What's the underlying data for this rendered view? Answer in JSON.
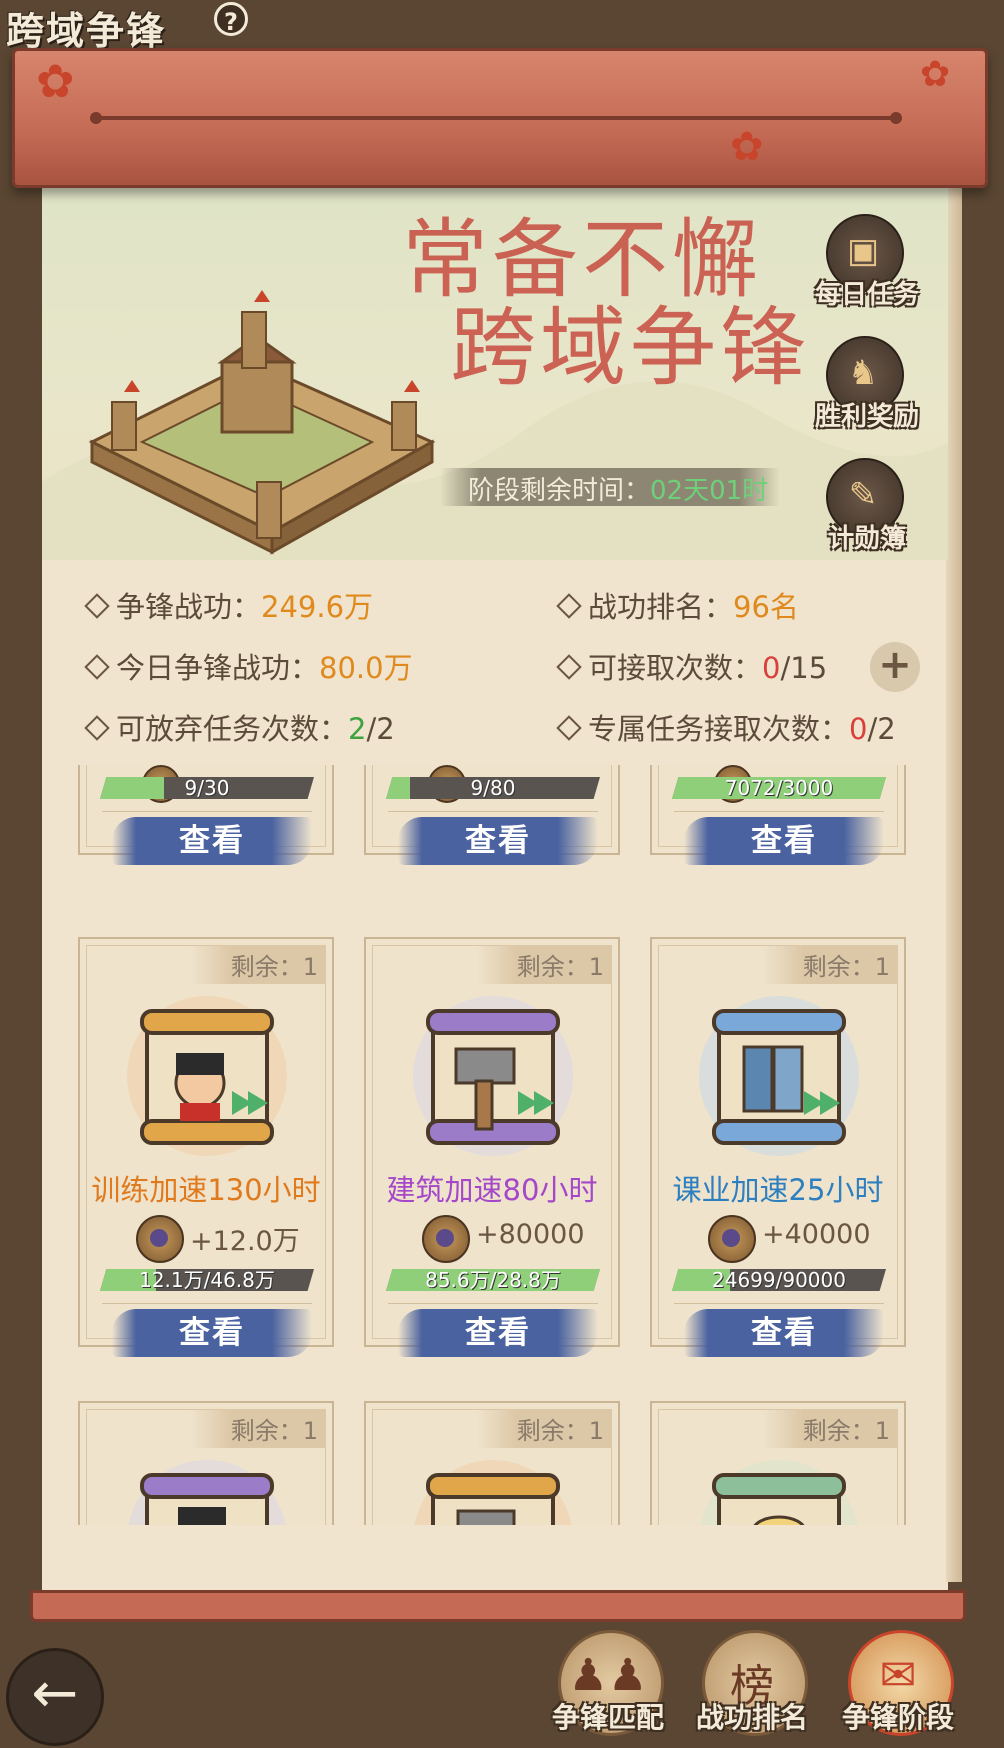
{
  "header": {
    "title": "跨域争锋",
    "help_icon": "?"
  },
  "hero": {
    "slogan_line1": "常备不懈",
    "slogan_line2": "跨域争锋",
    "timer_label": "阶段剩余时间：",
    "timer_value": "02天01时"
  },
  "side_buttons": [
    {
      "label": "每日任务",
      "icon": "treasure-chest-icon"
    },
    {
      "label": "胜利奖励",
      "icon": "horse-reward-icon"
    },
    {
      "label": "计勋簿",
      "icon": "scroll-book-icon"
    }
  ],
  "stats": {
    "merit_label": "争锋战功：",
    "merit_value": "249.6万",
    "rank_label": "战功排名：",
    "rank_value": "96名",
    "today_label": "今日争锋战功：",
    "today_value": "80.0万",
    "accept_label": "可接取次数：",
    "accept_used": "0",
    "accept_total": "/15",
    "abandon_label": "可放弃任务次数：",
    "abandon_used": "2",
    "abandon_total": "/2",
    "exclusive_label": "专属任务接取次数：",
    "exclusive_used": "0",
    "exclusive_total": "/2"
  },
  "view_label": "查看",
  "remaining_label": "剩余：1",
  "row_top": [
    {
      "progress_text": "9/30",
      "progress": 0.3
    },
    {
      "progress_text": "9/80",
      "progress": 0.11
    },
    {
      "progress_text": "7072/3000",
      "progress": 1.0
    }
  ],
  "row_mid": [
    {
      "name": "训练加速130小时",
      "color": "#e07a1e",
      "reward": "+12.0万",
      "progress_text": "12.1万/46.8万",
      "progress": 0.26
    },
    {
      "name": "建筑加速80小时",
      "color": "#a447c9",
      "reward": "+80000",
      "progress_text": "85.6万/28.8万",
      "progress": 1.0
    },
    {
      "name": "课业加速25小时",
      "color": "#2e7fc0",
      "reward": "+40000",
      "progress_text": "24699/90000",
      "progress": 0.27
    }
  ],
  "bottom_nav": [
    {
      "label": "争锋匹配",
      "icon": "soldiers-icon"
    },
    {
      "label": "战功排名",
      "icon": "ranking-board-icon",
      "emblem": "榜"
    },
    {
      "label": "争锋阶段",
      "icon": "stage-scroll-icon"
    }
  ],
  "colors": {
    "accent_orange": "#e08a1e",
    "red": "#d8403a",
    "green": "#3ea33e",
    "view_button": "#4a62a0"
  }
}
